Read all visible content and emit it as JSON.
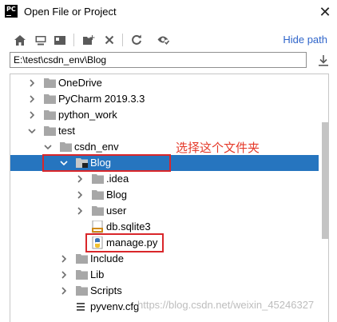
{
  "window": {
    "app_icon_text": "PC",
    "title": "Open File or Project",
    "close_glyph": "✕"
  },
  "toolbar": {
    "buttons": [
      "home-icon",
      "desktop-icon",
      "project-icon",
      "new-folder-icon",
      "delete-icon",
      "refresh-icon",
      "show-hidden-icon"
    ],
    "hide_path_label": "Hide path"
  },
  "path": {
    "value": "E:\\test\\csdn_env\\Blog"
  },
  "tree": {
    "items": [
      {
        "label": "OneDrive",
        "type": "folder",
        "state": "collapsed"
      },
      {
        "label": "PyCharm 2019.3.3",
        "type": "folder",
        "state": "collapsed"
      },
      {
        "label": "python_work",
        "type": "folder",
        "state": "collapsed"
      },
      {
        "label": "test",
        "type": "folder",
        "state": "expanded"
      },
      {
        "label": "csdn_env",
        "type": "folder",
        "state": "expanded"
      },
      {
        "label": "Blog",
        "type": "project-folder",
        "state": "expanded",
        "selected": true
      },
      {
        "label": ".idea",
        "type": "folder",
        "state": "collapsed"
      },
      {
        "label": "Blog",
        "type": "folder",
        "state": "collapsed"
      },
      {
        "label": "user",
        "type": "folder",
        "state": "collapsed"
      },
      {
        "label": "db.sqlite3",
        "type": "sql-file",
        "state": "leaf"
      },
      {
        "label": "manage.py",
        "type": "python-file",
        "state": "leaf"
      },
      {
        "label": "Include",
        "type": "folder",
        "state": "collapsed"
      },
      {
        "label": "Lib",
        "type": "folder",
        "state": "collapsed"
      },
      {
        "label": "Scripts",
        "type": "folder",
        "state": "collapsed"
      },
      {
        "label": "pyvenv.cfg",
        "type": "text-file",
        "state": "leaf"
      }
    ]
  },
  "annotation": {
    "text": "选择这个文件夹",
    "color": "#e53a2a"
  },
  "watermark": {
    "text": "https://blog.csdn.net/weixin_45246327"
  },
  "colors": {
    "selection": "#2675bf",
    "link": "#2f65ca",
    "highlight_box": "#d9262a",
    "folder": "#a7a7a7"
  }
}
